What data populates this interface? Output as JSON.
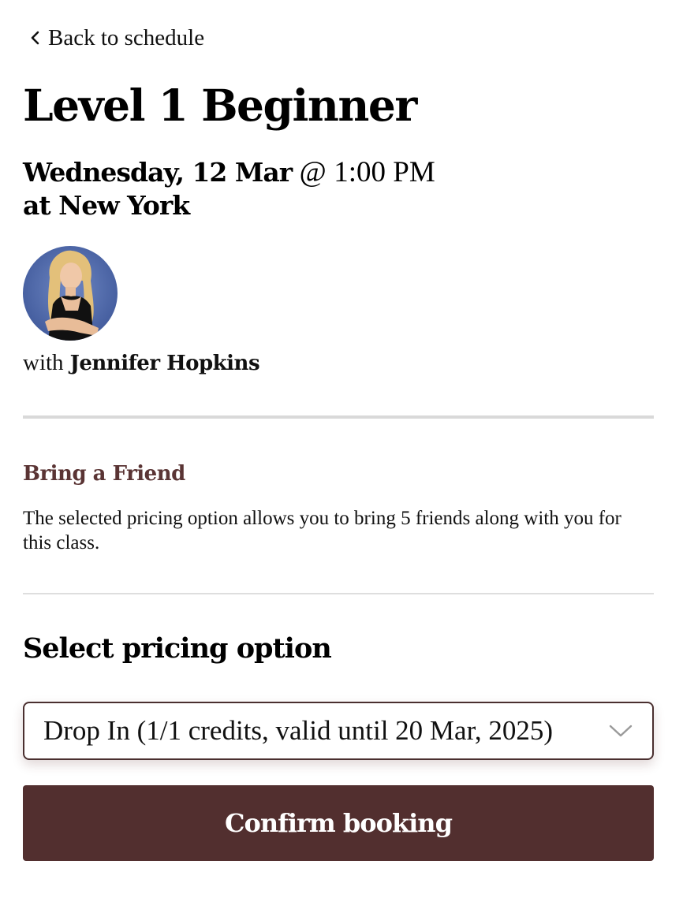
{
  "nav": {
    "back_label": "Back to schedule",
    "back_icon": "chevron-left-icon"
  },
  "class_info": {
    "title": "Level 1 Beginner",
    "date": "Wednesday, 12 Mar",
    "at_separator": "@",
    "time": "1:00 PM",
    "location": "at New York"
  },
  "instructor": {
    "prefix": "with",
    "name": "Jennifer Hopkins",
    "avatar": "instructor-photo"
  },
  "bring_friend": {
    "heading": "Bring a Friend",
    "description": "The selected pricing option allows you to bring 5 friends along with you for this class."
  },
  "pricing": {
    "heading": "Select pricing option",
    "selected_option": "Drop In (1/1 credits, valid until 20 Mar, 2025)",
    "dropdown_icon": "chevron-down-icon"
  },
  "actions": {
    "confirm_label": "Confirm booking"
  },
  "colors": {
    "brand": "#522f2f",
    "section_heading": "#5a3434",
    "divider": "#d9d9d9"
  }
}
